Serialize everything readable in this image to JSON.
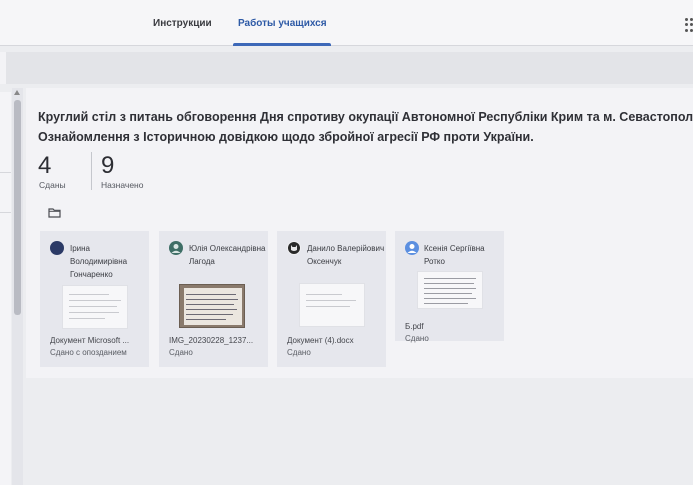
{
  "tabs": [
    {
      "label": "Инструкции"
    },
    {
      "label": "Работы учащихся"
    }
  ],
  "assignment": {
    "title_line1": "Круглий стіл з питань обговорення Дня спротиву окупації Автономної Республіки Крим та м. Севастополь.",
    "title_line2": "Ознайомлення з Історичною довідкою щодо збройної агресії РФ проти України."
  },
  "stats": {
    "submitted": {
      "value": "4",
      "label": "Сданы"
    },
    "assigned": {
      "value": "9",
      "label": "Назначено"
    }
  },
  "icons": {
    "folder": "folder-icon",
    "apps": "apps-grid-icon"
  },
  "submissions": [
    {
      "name": "Ірина Володимирівна Гончаренко",
      "file": "Документ Microsoft ...",
      "status": "Сдано с опозданием",
      "avatar_color": "#2b3a66"
    },
    {
      "name": "Юлія Олександрівна Лагода",
      "file": "IMG_20230228_1237...",
      "status": "Сдано",
      "avatar_color": "#3e6e66"
    },
    {
      "name": "Данило Валерійович Оксенчук",
      "file": "Документ (4).docx",
      "status": "Сдано",
      "avatar_color": "#2a2a2a"
    },
    {
      "name": "Ксенія Сергіївна Ротко",
      "file": "Б.pdf",
      "status": "Сдано",
      "avatar_color": "#5b8fe0"
    }
  ],
  "colors": {
    "accent": "#3d68b8",
    "background": "#ecedf0",
    "tile": "#e6e7ed"
  }
}
